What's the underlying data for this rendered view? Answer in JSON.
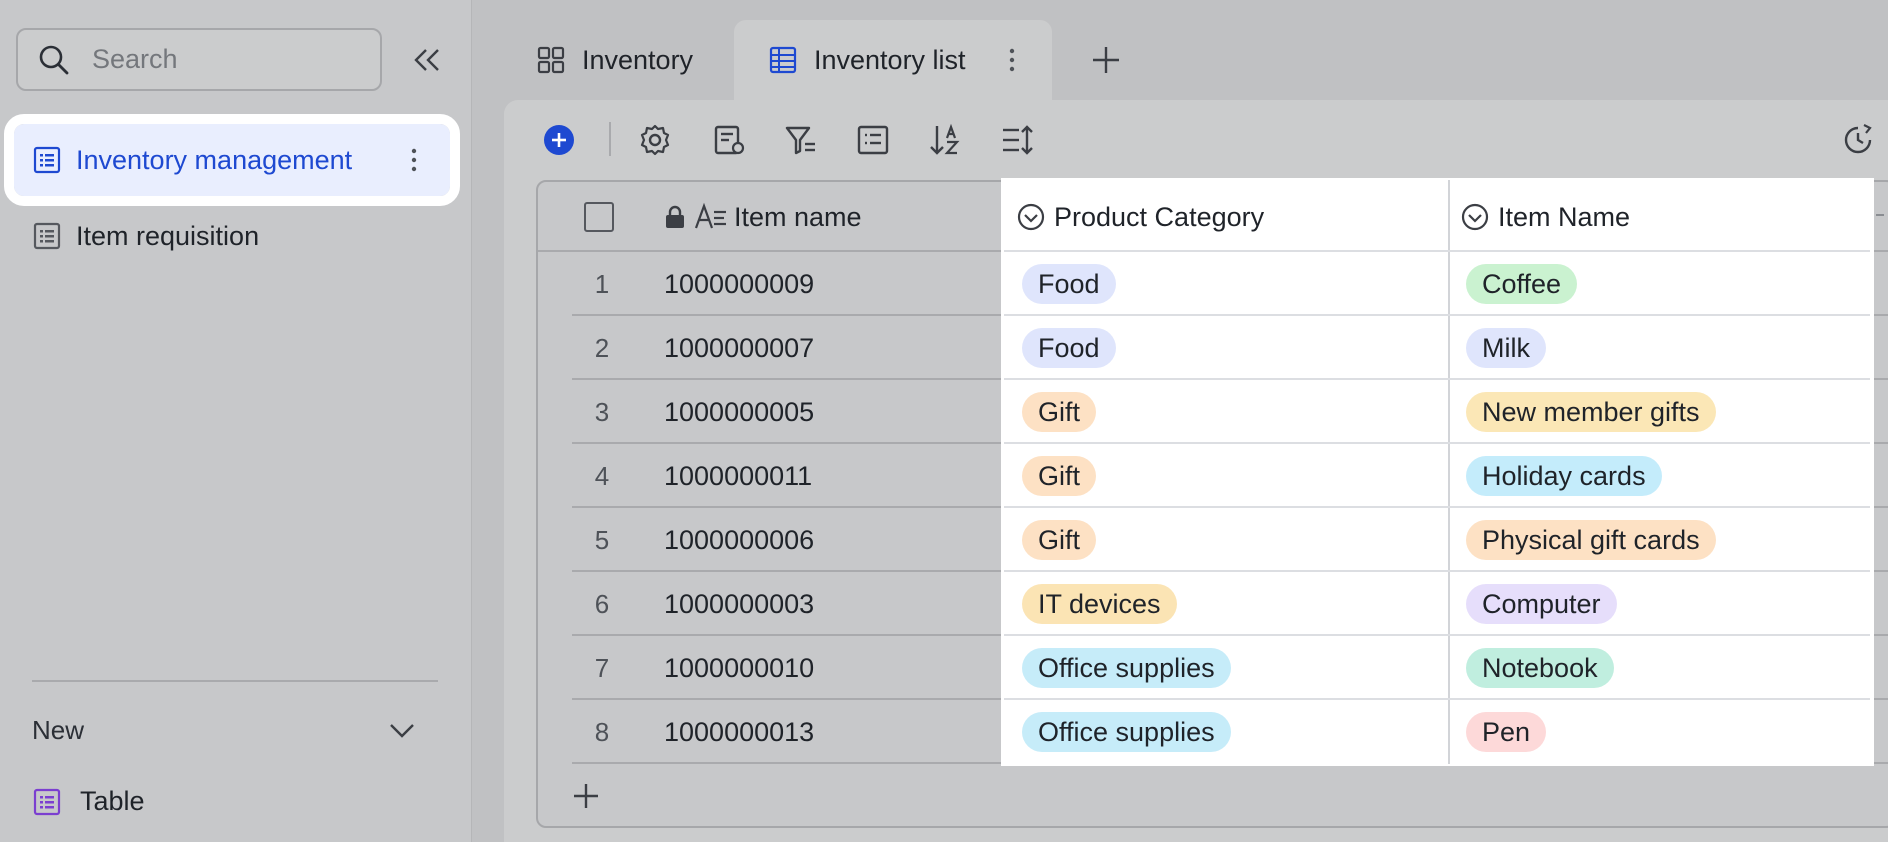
{
  "sidebar": {
    "search_placeholder": "Search",
    "items": [
      {
        "label": "Inventory management",
        "active": true
      },
      {
        "label": "Item requisition",
        "active": false
      }
    ],
    "new_section_label": "New",
    "new_items": [
      {
        "label": "Table"
      }
    ]
  },
  "tabs": [
    {
      "label": "Inventory",
      "icon": "grid-icon"
    },
    {
      "label": "Inventory list",
      "icon": "table-icon",
      "active": true
    }
  ],
  "table": {
    "columns": [
      "Item name",
      "Product Category",
      "Item Name"
    ],
    "rows": [
      {
        "num": "1",
        "id": "1000000009",
        "category": "Food",
        "item": "Coffee"
      },
      {
        "num": "2",
        "id": "1000000007",
        "category": "Food",
        "item": "Milk"
      },
      {
        "num": "3",
        "id": "1000000005",
        "category": "Gift",
        "item": "New member gifts"
      },
      {
        "num": "4",
        "id": "1000000011",
        "category": "Gift",
        "item": "Holiday cards"
      },
      {
        "num": "5",
        "id": "1000000006",
        "category": "Gift",
        "item": "Physical gift cards"
      },
      {
        "num": "6",
        "id": "1000000003",
        "category": "IT devices",
        "item": "Computer"
      },
      {
        "num": "7",
        "id": "1000000010",
        "category": "Office supplies",
        "item": "Notebook"
      },
      {
        "num": "8",
        "id": "1000000013",
        "category": "Office supplies",
        "item": "Pen"
      }
    ]
  },
  "colors": {
    "accent": "#1e49d1",
    "tag_food": "#dfe5fc",
    "tag_gift": "#fde1c4",
    "tag_it": "#fbe4b4",
    "tag_office": "#c6ecf9",
    "tag_coffee": "#caf2d0",
    "tag_milk": "#dfe5fc",
    "tag_new_member": "#fbe7b6",
    "tag_holiday": "#c4ecfb",
    "tag_physical": "#fde1c4",
    "tag_computer": "#e6defb",
    "tag_notebook": "#c0eedf",
    "tag_pen": "#fdd9d9"
  }
}
